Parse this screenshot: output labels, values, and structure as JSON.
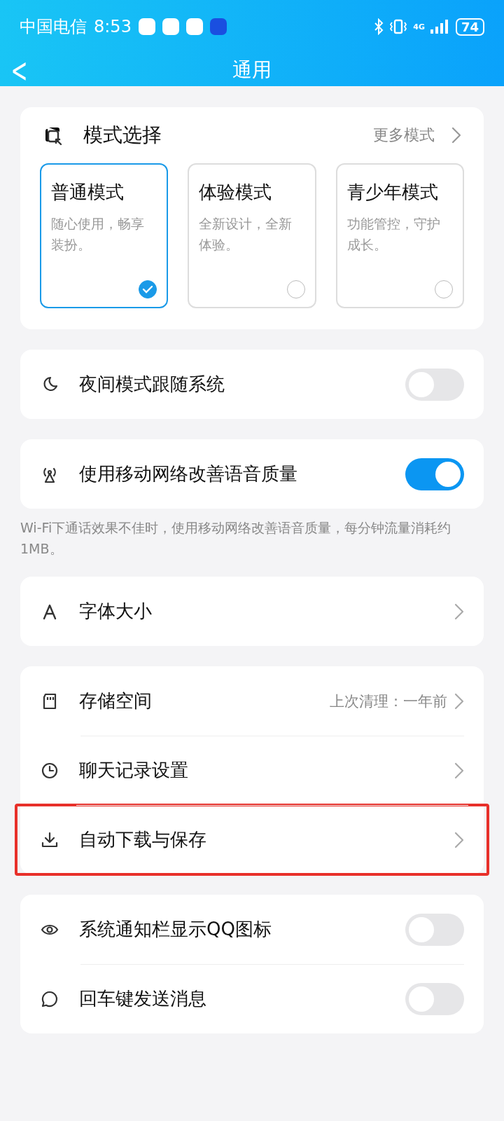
{
  "status_bar": {
    "carrier": "中国电信",
    "time": "8:53",
    "network": "4G",
    "battery": "74"
  },
  "header": {
    "back": "<",
    "title": "通用"
  },
  "mode_select": {
    "title": "模式选择",
    "more": "更多模式",
    "modes": [
      {
        "name": "普通模式",
        "desc": "随心使用，畅享装扮。",
        "selected": true
      },
      {
        "name": "体验模式",
        "desc": "全新设计，全新体验。",
        "selected": false
      },
      {
        "name": "青少年模式",
        "desc": "功能管控，守护成长。",
        "selected": false
      }
    ]
  },
  "groups": [
    {
      "items": [
        {
          "kind": "toggle",
          "label": "夜间模式跟随系统",
          "on": false
        }
      ]
    },
    {
      "items": [
        {
          "kind": "toggle",
          "label": "使用移动网络改善语音质量",
          "on": true
        }
      ],
      "note": "Wi-Fi下通话效果不佳时，使用移动网络改善语音质量，每分钟流量消耗约1MB。"
    },
    {
      "items": [
        {
          "kind": "link",
          "label": "字体大小"
        }
      ]
    },
    {
      "items": [
        {
          "kind": "link",
          "label": "存储空间",
          "value": "上次清理：一年前"
        },
        {
          "kind": "link",
          "label": "聊天记录设置"
        },
        {
          "kind": "link",
          "label": "自动下载与保存",
          "highlighted": true
        }
      ]
    },
    {
      "items": [
        {
          "kind": "toggle",
          "label": "系统通知栏显示QQ图标",
          "on": false
        },
        {
          "kind": "toggle",
          "label": "回车键发送消息",
          "on": false
        }
      ]
    }
  ]
}
